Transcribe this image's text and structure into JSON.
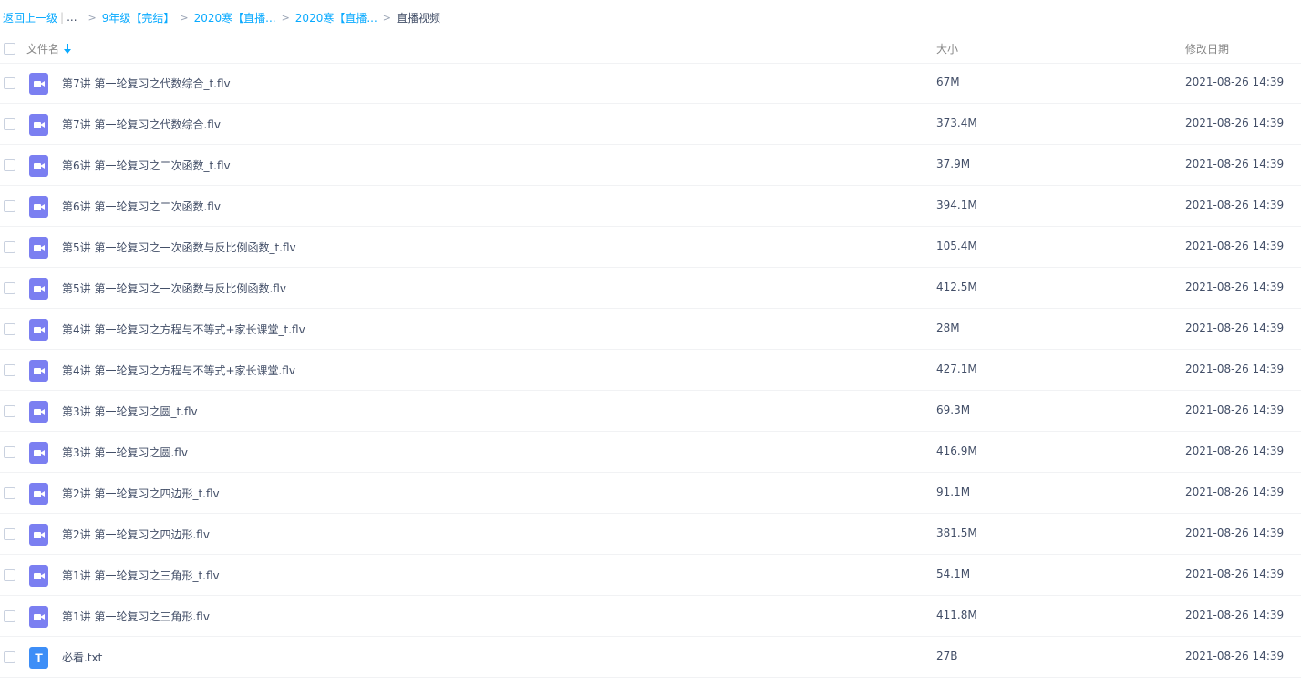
{
  "breadcrumb": {
    "back_label": "返回上一级",
    "ellipsis": "...",
    "items": [
      "9年级【完结】",
      "2020寒【直播...",
      "2020寒【直播..."
    ],
    "current": "直播视频",
    "arrow": ">"
  },
  "columns": {
    "name": "文件名",
    "size": "大小",
    "date": "修改日期"
  },
  "colors": {
    "accent": "#09aaff",
    "video_icon": "#7b7ff1",
    "text_icon": "#3d8ef7"
  },
  "files": [
    {
      "name": "第7讲 第一轮复习之代数综合_t.flv",
      "size": "67M",
      "date": "2021-08-26 14:39",
      "icon": "video-icon"
    },
    {
      "name": "第7讲 第一轮复习之代数综合.flv",
      "size": "373.4M",
      "date": "2021-08-26 14:39",
      "icon": "video-icon"
    },
    {
      "name": "第6讲 第一轮复习之二次函数_t.flv",
      "size": "37.9M",
      "date": "2021-08-26 14:39",
      "icon": "video-icon"
    },
    {
      "name": "第6讲 第一轮复习之二次函数.flv",
      "size": "394.1M",
      "date": "2021-08-26 14:39",
      "icon": "video-icon"
    },
    {
      "name": "第5讲 第一轮复习之一次函数与反比例函数_t.flv",
      "size": "105.4M",
      "date": "2021-08-26 14:39",
      "icon": "video-icon"
    },
    {
      "name": "第5讲 第一轮复习之一次函数与反比例函数.flv",
      "size": "412.5M",
      "date": "2021-08-26 14:39",
      "icon": "video-icon"
    },
    {
      "name": "第4讲 第一轮复习之方程与不等式+家长课堂_t.flv",
      "size": "28M",
      "date": "2021-08-26 14:39",
      "icon": "video-icon"
    },
    {
      "name": "第4讲 第一轮复习之方程与不等式+家长课堂.flv",
      "size": "427.1M",
      "date": "2021-08-26 14:39",
      "icon": "video-icon"
    },
    {
      "name": "第3讲 第一轮复习之圆_t.flv",
      "size": "69.3M",
      "date": "2021-08-26 14:39",
      "icon": "video-icon"
    },
    {
      "name": "第3讲 第一轮复习之圆.flv",
      "size": "416.9M",
      "date": "2021-08-26 14:39",
      "icon": "video-icon"
    },
    {
      "name": "第2讲 第一轮复习之四边形_t.flv",
      "size": "91.1M",
      "date": "2021-08-26 14:39",
      "icon": "video-icon"
    },
    {
      "name": "第2讲 第一轮复习之四边形.flv",
      "size": "381.5M",
      "date": "2021-08-26 14:39",
      "icon": "video-icon"
    },
    {
      "name": "第1讲 第一轮复习之三角形_t.flv",
      "size": "54.1M",
      "date": "2021-08-26 14:39",
      "icon": "video-icon"
    },
    {
      "name": "第1讲 第一轮复习之三角形.flv",
      "size": "411.8M",
      "date": "2021-08-26 14:39",
      "icon": "video-icon"
    },
    {
      "name": "必看.txt",
      "size": "27B",
      "date": "2021-08-26 14:39",
      "icon": "text-file-icon",
      "icon_glyph": "T"
    }
  ]
}
